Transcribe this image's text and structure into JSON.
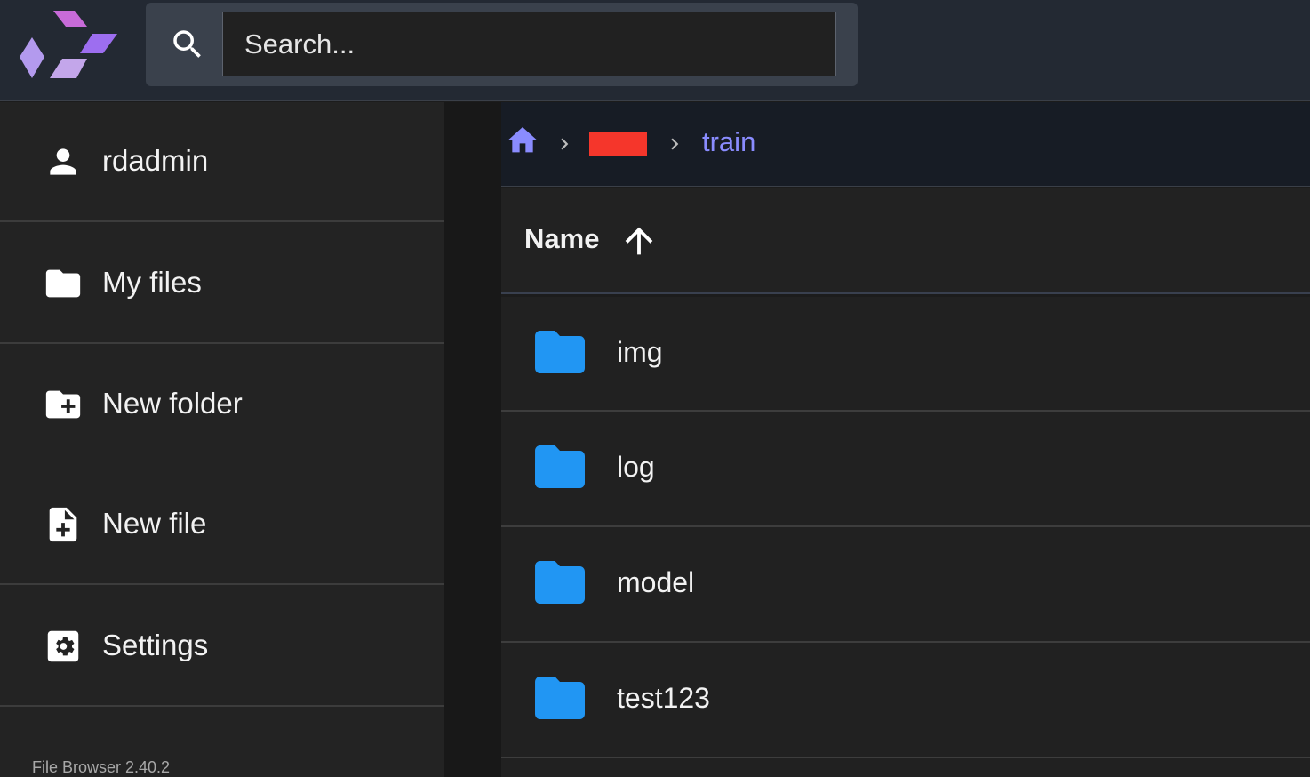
{
  "search": {
    "placeholder": "Search..."
  },
  "sidebar": {
    "items": [
      {
        "label": "rdadmin",
        "icon": "person-icon"
      },
      {
        "label": "My files",
        "icon": "folder-icon"
      },
      {
        "label": "New folder",
        "icon": "create-new-folder-icon"
      },
      {
        "label": "New file",
        "icon": "note-add-icon"
      },
      {
        "label": "Settings",
        "icon": "settings-icon"
      }
    ],
    "version": "File Browser 2.40.2"
  },
  "breadcrumb": {
    "home_icon": "home-icon",
    "current": "train",
    "redacted_color": "#f5362b"
  },
  "listing": {
    "column_name": "Name",
    "sort_icon": "arrow-upward-icon",
    "items": [
      {
        "name": "img",
        "type": "folder"
      },
      {
        "name": "log",
        "type": "folder"
      },
      {
        "name": "model",
        "type": "folder"
      },
      {
        "name": "test123",
        "type": "folder"
      }
    ]
  },
  "colors": {
    "accent": "#8a8cff",
    "folder": "#2196f3",
    "header_bg": "#232933",
    "sidebar_bg": "#232323"
  }
}
